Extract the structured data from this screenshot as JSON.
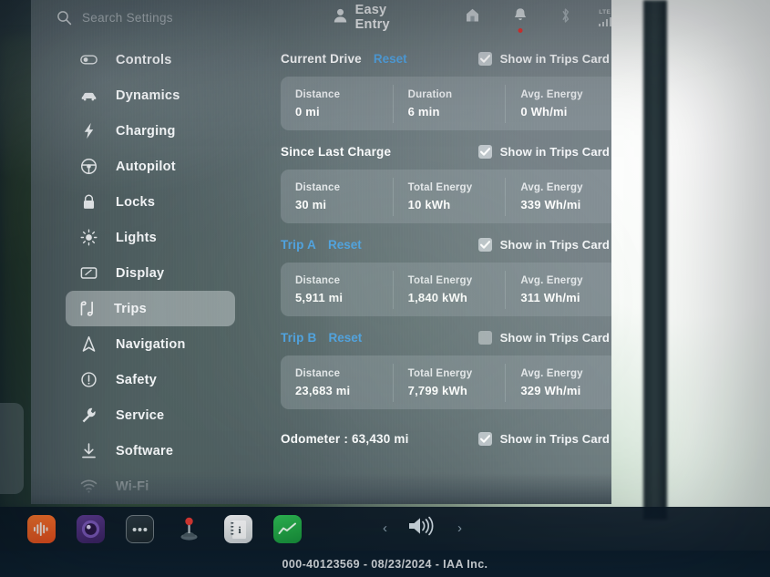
{
  "header": {
    "search": {
      "placeholder": "Search Settings",
      "value": "",
      "icon": "search-icon"
    },
    "easy_entry_label": "Easy Entry",
    "profile_icon": "person-icon",
    "home_icon": "home-icon",
    "bell_icon": "bell-icon",
    "bluetooth_icon": "bluetooth-icon",
    "signal_label": "LTE",
    "signal_icon": "signal-bars-icon"
  },
  "sidebar": {
    "items": [
      {
        "label": "Controls",
        "icon": "toggle-icon",
        "selected": false,
        "dim": false
      },
      {
        "label": "Dynamics",
        "icon": "car-icon",
        "selected": false,
        "dim": false
      },
      {
        "label": "Charging",
        "icon": "lightning-bolt-icon",
        "selected": false,
        "dim": false
      },
      {
        "label": "Autopilot",
        "icon": "steering-wheel-icon",
        "selected": false,
        "dim": false
      },
      {
        "label": "Locks",
        "icon": "padlock-icon",
        "selected": false,
        "dim": false
      },
      {
        "label": "Lights",
        "icon": "brightness-icon",
        "selected": false,
        "dim": false
      },
      {
        "label": "Display",
        "icon": "display-icon",
        "selected": false,
        "dim": false
      },
      {
        "label": "Trips",
        "icon": "trips-icon",
        "selected": true,
        "dim": false
      },
      {
        "label": "Navigation",
        "icon": "navigation-arrow-icon",
        "selected": false,
        "dim": false
      },
      {
        "label": "Safety",
        "icon": "alert-circle-icon",
        "selected": false,
        "dim": false
      },
      {
        "label": "Service",
        "icon": "wrench-icon",
        "selected": false,
        "dim": false
      },
      {
        "label": "Software",
        "icon": "download-icon",
        "selected": false,
        "dim": false
      },
      {
        "label": "Wi-Fi",
        "icon": "wifi-icon",
        "selected": false,
        "dim": true
      }
    ]
  },
  "content": {
    "show_in_trips_label": "Show in Trips Card",
    "reset_label": "Reset",
    "sections": [
      {
        "title": "Current Drive",
        "title_is_link": false,
        "has_reset": true,
        "show_in_trips_card": true,
        "stats": [
          {
            "key": "Distance",
            "value": "0 mi"
          },
          {
            "key": "Duration",
            "value": "6 min"
          },
          {
            "key": "Avg. Energy",
            "value": "0 Wh/mi"
          }
        ]
      },
      {
        "title": "Since Last Charge",
        "title_is_link": false,
        "has_reset": false,
        "show_in_trips_card": true,
        "stats": [
          {
            "key": "Distance",
            "value": "30 mi"
          },
          {
            "key": "Total Energy",
            "value": "10 kWh"
          },
          {
            "key": "Avg. Energy",
            "value": "339 Wh/mi"
          }
        ]
      },
      {
        "title": "Trip A",
        "title_is_link": true,
        "has_reset": true,
        "show_in_trips_card": true,
        "stats": [
          {
            "key": "Distance",
            "value": "5,911 mi"
          },
          {
            "key": "Total Energy",
            "value": "1,840 kWh"
          },
          {
            "key": "Avg. Energy",
            "value": "311 Wh/mi"
          }
        ]
      },
      {
        "title": "Trip B",
        "title_is_link": true,
        "has_reset": true,
        "show_in_trips_card": false,
        "stats": [
          {
            "key": "Distance",
            "value": "23,683 mi"
          },
          {
            "key": "Total Energy",
            "value": "7,799 kWh"
          },
          {
            "key": "Avg. Energy",
            "value": "329 Wh/mi"
          }
        ]
      }
    ],
    "odometer": {
      "text": "Odometer :  63,430 mi",
      "show_in_trips_card": true
    }
  },
  "dock": {
    "apps": [
      {
        "name": "audio-app",
        "icon": "audio-waveform-icon"
      },
      {
        "name": "camera-app",
        "icon": "dashcam-camera-icon"
      },
      {
        "name": "toybox-app",
        "icon": "three-dots-icon"
      },
      {
        "name": "joystick-app",
        "icon": "joystick-icon"
      },
      {
        "name": "manual-app",
        "icon": "owners-manual-icon"
      },
      {
        "name": "energy-app",
        "icon": "energy-graph-icon"
      }
    ],
    "volume": {
      "prev_icon": "chevron-left-icon",
      "speaker_icon": "speaker-icon",
      "next_icon": "chevron-right-icon"
    }
  },
  "watermark": {
    "text": "000-40123569 - 08/23/2024 - IAA Inc."
  },
  "colors": {
    "link_blue": "#4fa3e3",
    "panel_gray": "#56646c",
    "card_gray": "#929da3",
    "text_white": "#ffffff",
    "notification_red": "#e8312f"
  }
}
